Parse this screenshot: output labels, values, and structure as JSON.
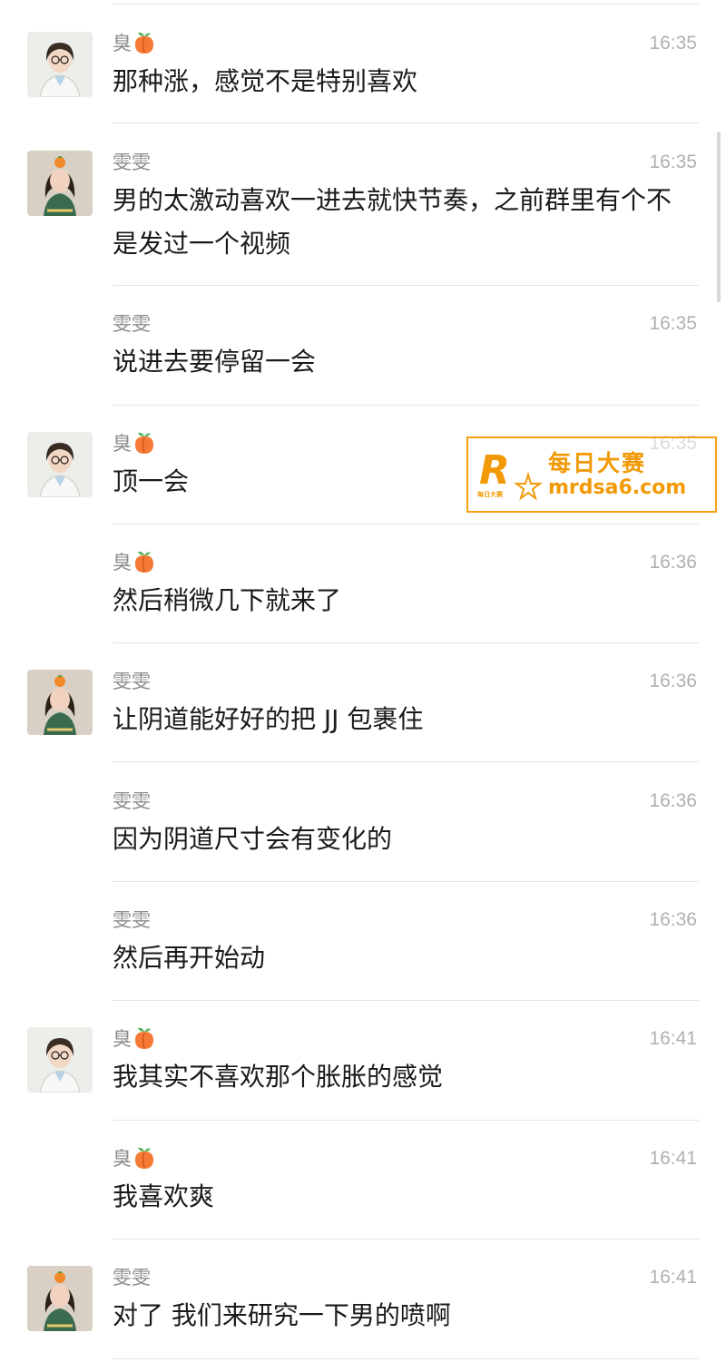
{
  "senders": {
    "chou": {
      "name": "臭",
      "emoji": "peach-emoji",
      "avatar": "doctor-girl-avatar"
    },
    "wenwen": {
      "name": "雯雯",
      "avatar": "photo-girl-avatar"
    }
  },
  "messages": [
    {
      "sender": "臭",
      "time": "16:35",
      "text": "那种涨，感觉不是特别喜欢"
    },
    {
      "sender": "雯雯",
      "time": "16:35",
      "text": "男的太激动喜欢一进去就快节奏，之前群里有个不是发过一个视频"
    },
    {
      "sender": "雯雯",
      "time": "16:35",
      "text": "说进去要停留一会"
    },
    {
      "sender": "臭",
      "time": "16:35",
      "text": "顶一会"
    },
    {
      "sender": "臭",
      "time": "16:36",
      "text": "然后稍微几下就来了"
    },
    {
      "sender": "雯雯",
      "time": "16:36",
      "text": "让阴道能好好的把 JJ 包裹住"
    },
    {
      "sender": "雯雯",
      "time": "16:36",
      "text": "因为阴道尺寸会有变化的"
    },
    {
      "sender": "雯雯",
      "time": "16:36",
      "text": "然后再开始动"
    },
    {
      "sender": "臭",
      "time": "16:41",
      "text": "我其实不喜欢那个胀胀的感觉"
    },
    {
      "sender": "臭",
      "time": "16:41",
      "text": "我喜欢爽"
    },
    {
      "sender": "雯雯",
      "time": "16:41",
      "text": "对了 我们来研究一下男的喷啊"
    }
  ],
  "watermark": {
    "logo_letter": "R",
    "logo_small": "每日大赛",
    "title": "每日大赛",
    "url": "mrdsa6.com",
    "color": "#f29a06"
  },
  "colors": {
    "sender": "#8c8c8c",
    "time": "#b0b0b0",
    "text": "#1a1a1a",
    "divider": "#e4e4e4"
  }
}
